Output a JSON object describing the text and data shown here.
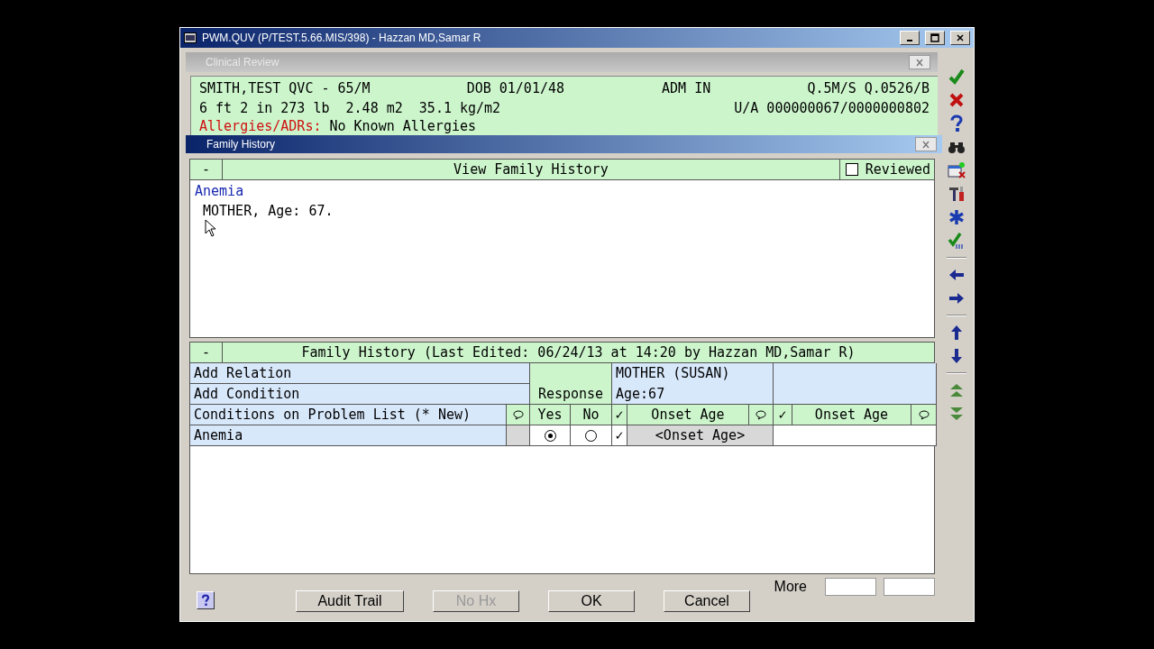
{
  "window": {
    "title": "PWM.QUV (P/TEST.5.66.MIS/398) - Hazzan MD,Samar R"
  },
  "clinical_review": {
    "title": "Clinical Review",
    "name_line": "SMITH,TEST QVC - 65/M",
    "dob": "DOB 01/01/48",
    "admission": "ADM IN",
    "codes": "Q.5M/S Q.0526/B",
    "measurements": "6 ft 2 in 273 lb  2.48 m2  35.1 kg/m2",
    "account": "U/A 000000067/0000000802",
    "allergies_label": "Allergies/ADRs:",
    "allergies_value": "No Known Allergies"
  },
  "family_history": {
    "title": "Family History",
    "view": {
      "collapse": "-",
      "header": "View Family History",
      "reviewed_label": "Reviewed",
      "reviewed": false,
      "entries": [
        {
          "condition": "Anemia",
          "relation": "MOTHER, Age: 67."
        }
      ]
    },
    "grid": {
      "collapse": "-",
      "header": "Family History (Last Edited: 06/24/13 at 14:20 by Hazzan MD,Samar R)",
      "add_relation": "Add Relation",
      "add_condition": "Add Condition",
      "response_label": "Response",
      "conditions_label": "Conditions on Problem List (* New)",
      "yes_label": "Yes",
      "no_label": "No",
      "relatives": [
        {
          "name": "MOTHER (SUSAN)",
          "age": "Age:67",
          "check": "✓",
          "onset_label": "Onset Age"
        },
        {
          "check": "✓",
          "onset_label": "Onset Age"
        }
      ],
      "rows": [
        {
          "condition": "Anemia",
          "yes_selected": true,
          "no_selected": false,
          "onset_check": "✓",
          "onset_age": "<Onset Age>"
        }
      ]
    }
  },
  "buttons": [
    {
      "label": "Audit Trail",
      "disabled": false
    },
    {
      "label": "No Hx",
      "disabled": true
    },
    {
      "label": "OK",
      "disabled": false
    },
    {
      "label": "Cancel",
      "disabled": false
    }
  ],
  "more_label": "More"
}
